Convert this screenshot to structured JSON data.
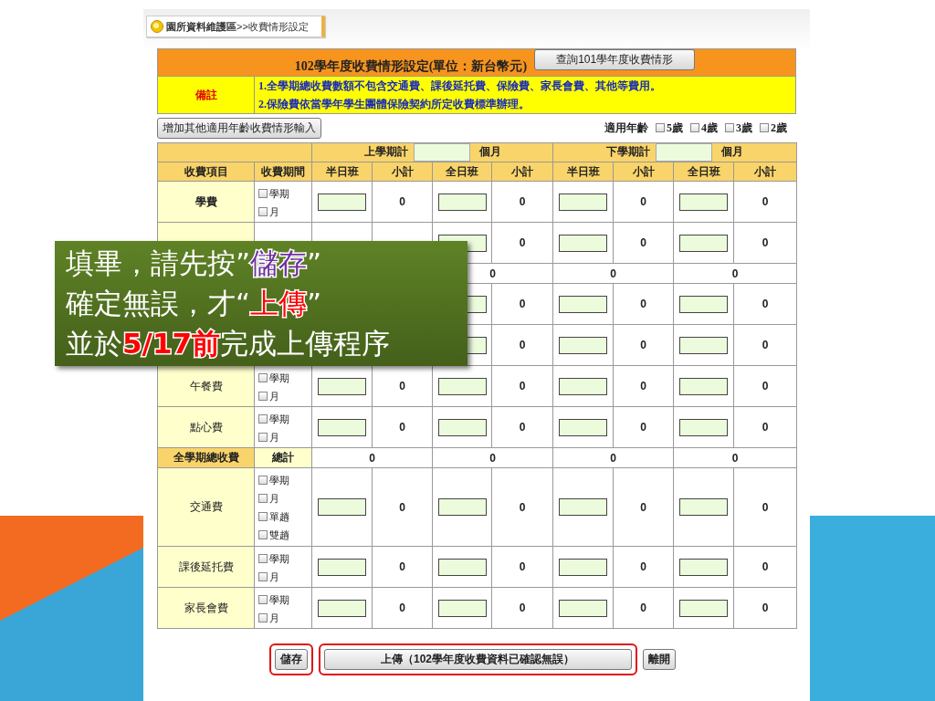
{
  "breadcrumb": "**園所資料維護區**>>收費情形設定",
  "title": "102學年度收費情形設定(單位：新台幣元)",
  "query_button": "查詢101學年度收費情形",
  "note": {
    "label": "備註",
    "lines": [
      "1.全學期總收費數額不包含交通費、課後延托費、保險費、家長會費、其他等費用。",
      "2.保險費依當學年學生團體保險契約所定收費標準辦理。"
    ]
  },
  "add_button": "增加其他適用年齡收費情形輸入",
  "age_filter": {
    "label": "適用年齡",
    "options": [
      {
        "label": "5歲",
        "checked": false
      },
      {
        "label": "4歲",
        "checked": false
      },
      {
        "label": "3歲",
        "checked": false
      },
      {
        "label": "2歲",
        "checked": false
      }
    ]
  },
  "table": {
    "semesters": [
      {
        "label": "上學期計",
        "unit": "個月"
      },
      {
        "label": "下學期計",
        "unit": "個月"
      }
    ],
    "columns": [
      "收費項目",
      "收費期間",
      "半日班",
      "小計",
      "全日班",
      "小計",
      "半日班",
      "小計",
      "全日班",
      "小計"
    ],
    "rows": [
      {
        "kind": "item",
        "name": "學費",
        "bold": true,
        "periods": [
          {
            "label": "學期",
            "checked": false
          },
          {
            "label": "月",
            "checked": false
          }
        ],
        "subtotals": [
          "0",
          "0",
          "0",
          "0"
        ]
      },
      {
        "kind": "item",
        "subtotals": [
          "0",
          "0",
          "0"
        ]
      },
      {
        "kind": "subtotal",
        "values": [
          "0",
          "0",
          "0"
        ]
      },
      {
        "kind": "item",
        "subtotals": [
          "0",
          "0",
          "0"
        ]
      },
      {
        "kind": "item",
        "subtotals": [
          "0",
          "0",
          "0"
        ]
      },
      {
        "kind": "item",
        "name": "午餐費",
        "bold": false,
        "periods": [
          {
            "label": "學期",
            "checked": false
          },
          {
            "label": "月",
            "checked": false
          }
        ],
        "subtotals": [
          "0",
          "0",
          "0",
          "0"
        ]
      },
      {
        "kind": "item",
        "name": "點心費",
        "bold": false,
        "periods": [
          {
            "label": "學期",
            "checked": false
          },
          {
            "label": "月",
            "checked": false
          }
        ],
        "subtotals": [
          "0",
          "0",
          "0",
          "0"
        ]
      },
      {
        "kind": "total",
        "name": "全學期總收費",
        "period": "總計",
        "values": [
          "0",
          "0",
          "0",
          "0"
        ]
      },
      {
        "kind": "item",
        "name": "交通費",
        "bold": false,
        "periods": [
          {
            "label": "學期",
            "checked": false
          },
          {
            "label": "月",
            "checked": false
          },
          {
            "label": "單趟",
            "checked": false
          },
          {
            "label": "雙趟",
            "checked": false
          }
        ],
        "subtotals": [
          "0",
          "0",
          "0",
          "0"
        ]
      },
      {
        "kind": "item",
        "name": "課後延托費",
        "bold": false,
        "periods": [
          {
            "label": "學期",
            "checked": false
          },
          {
            "label": "月",
            "checked": false
          }
        ],
        "subtotals": [
          "0",
          "0",
          "0",
          "0"
        ]
      },
      {
        "kind": "item",
        "name": "家長會費",
        "bold": false,
        "periods": [
          {
            "label": "學期",
            "checked": false
          },
          {
            "label": "月",
            "checked": false
          }
        ],
        "subtotals": [
          "0",
          "0",
          "0",
          "0"
        ]
      }
    ]
  },
  "actions": [
    {
      "label": "儲存",
      "highlighted": true,
      "wide": false
    },
    {
      "label": "上傳（102學年度收費資料已確認無誤）",
      "highlighted": true,
      "wide": true
    },
    {
      "label": "離開",
      "highlighted": false,
      "wide": false
    }
  ],
  "callout": {
    "lines": [
      [
        {
          "text": "填畢，請先按”"
        },
        {
          "text": "儲存",
          "color": "#7030a0"
        },
        {
          "text": "”"
        }
      ],
      [
        {
          "text": "確定無誤，才“"
        },
        {
          "text": "上傳",
          "color": "#ff0000"
        },
        {
          "text": "”"
        }
      ],
      [
        {
          "text": "並於"
        },
        {
          "text": "**5/17前**",
          "color": "#ff0000"
        },
        {
          "text": "完成上傳程序"
        }
      ]
    ]
  }
}
